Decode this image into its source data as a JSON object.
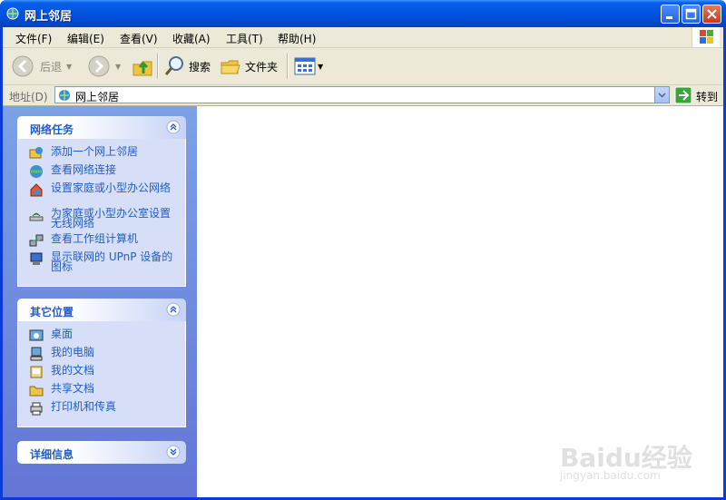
{
  "window": {
    "title": "网上邻居"
  },
  "menu": [
    {
      "label": "文件(F)"
    },
    {
      "label": "编辑(E)"
    },
    {
      "label": "查看(V)"
    },
    {
      "label": "收藏(A)"
    },
    {
      "label": "工具(T)"
    },
    {
      "label": "帮助(H)"
    }
  ],
  "toolbar": {
    "back": "后退",
    "search": "搜索",
    "folders": "文件夹"
  },
  "address": {
    "label": "地址(D)",
    "value": "网上邻居",
    "go": "转到"
  },
  "panels": {
    "network_tasks": {
      "title": "网络任务",
      "items": [
        {
          "label": "添加一个网上邻居",
          "icon": "add-network-place-icon"
        },
        {
          "label": "查看网络连接",
          "icon": "network-connections-icon"
        },
        {
          "label": "设置家庭或小型办公网络",
          "icon": "home-network-icon"
        },
        {
          "label": "为家庭或小型办公室设置无线网络",
          "icon": "wireless-network-icon"
        },
        {
          "label": "查看工作组计算机",
          "icon": "workgroup-computers-icon"
        },
        {
          "label": "显示联网的 UPnP 设备的图标",
          "icon": "upnp-device-icon"
        }
      ]
    },
    "other_places": {
      "title": "其它位置",
      "items": [
        {
          "label": "桌面",
          "icon": "desktop-icon"
        },
        {
          "label": "我的电脑",
          "icon": "my-computer-icon"
        },
        {
          "label": "我的文档",
          "icon": "my-documents-icon"
        },
        {
          "label": "共享文档",
          "icon": "shared-documents-icon"
        },
        {
          "label": "打印机和传真",
          "icon": "printers-icon"
        }
      ]
    },
    "details": {
      "title": "详细信息"
    }
  },
  "watermark": {
    "text": "Baidu经验",
    "sub": "jingyan.baidu.com"
  }
}
